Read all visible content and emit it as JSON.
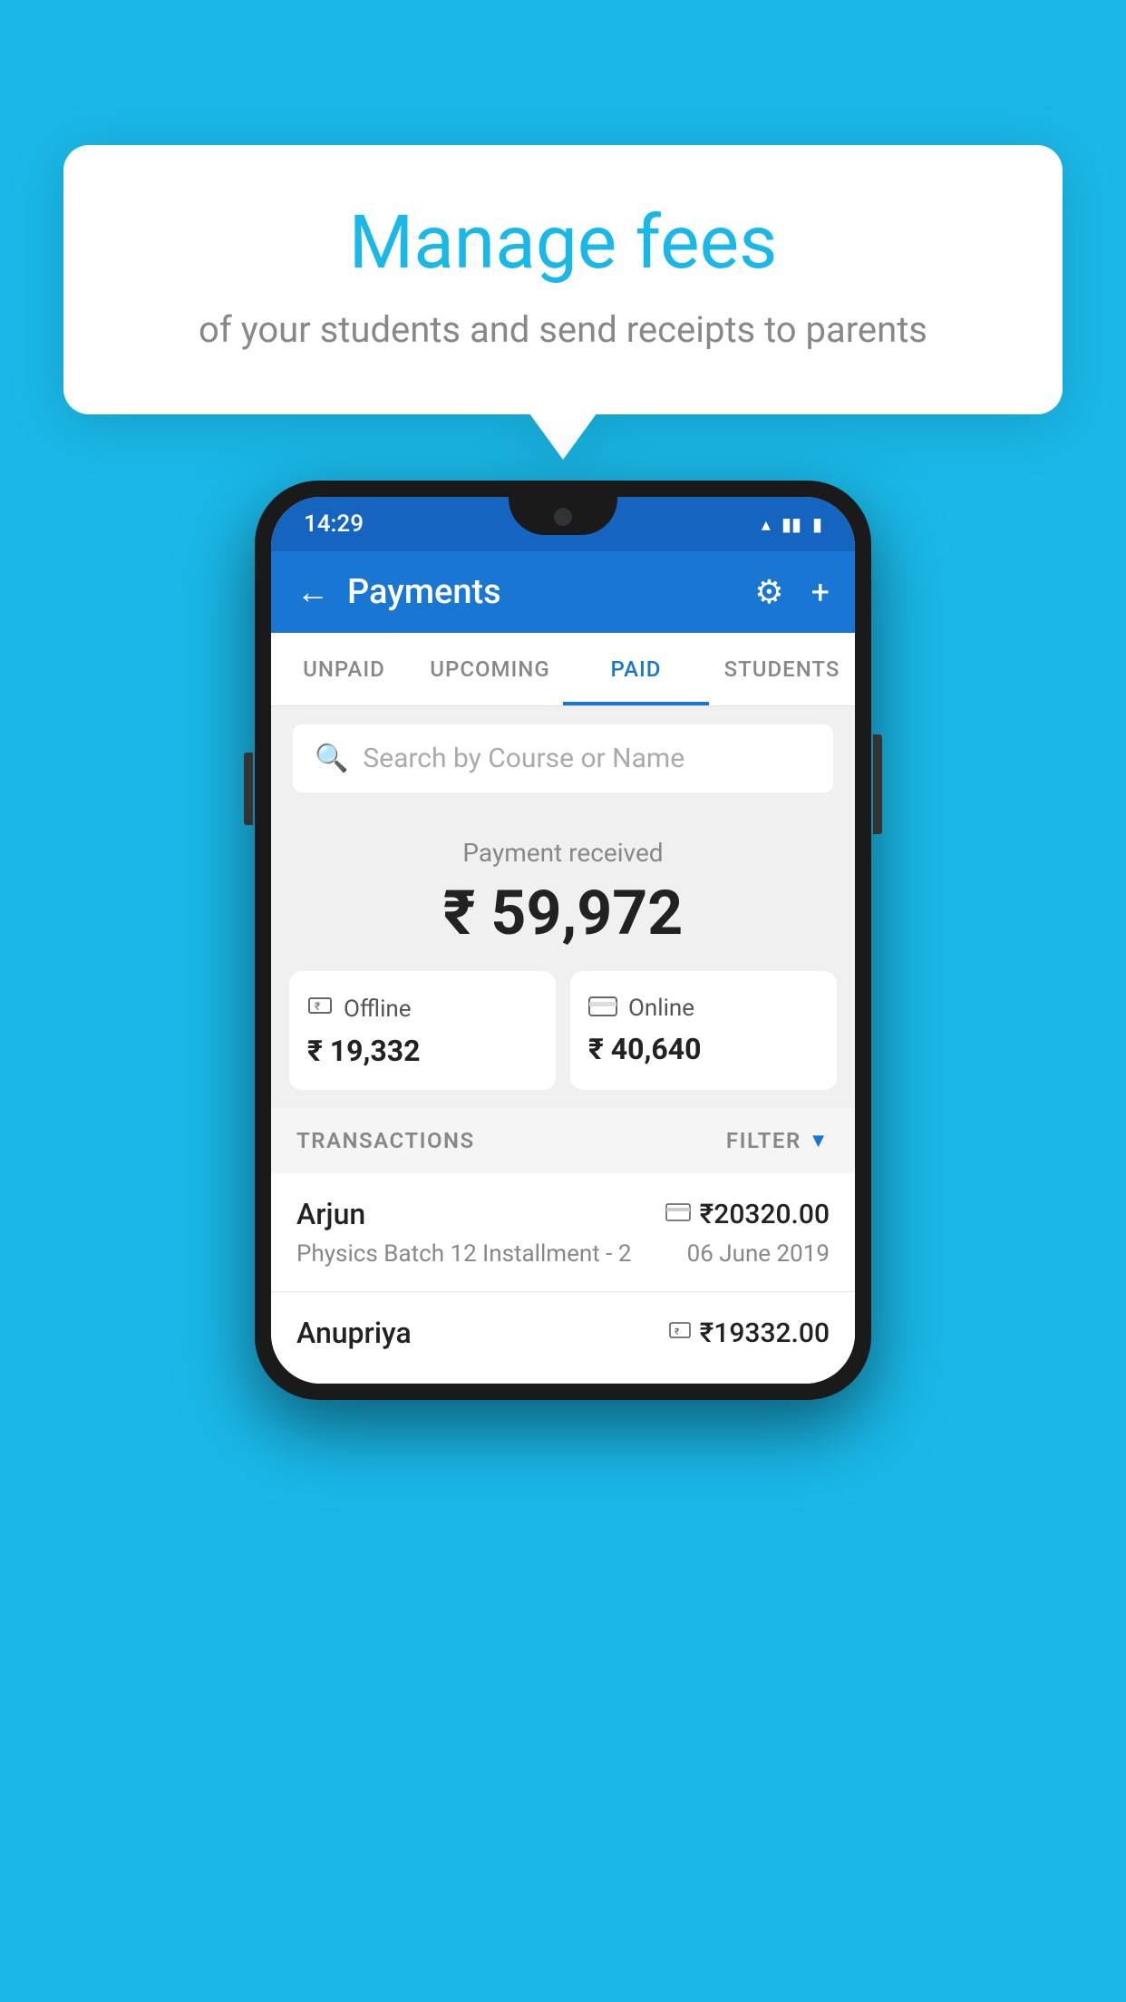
{
  "background_color": "#1ab8e8",
  "tooltip": {
    "title": "Manage fees",
    "subtitle": "of your students and send receipts to parents"
  },
  "phone": {
    "status_bar": {
      "time": "14:29",
      "icons": [
        "wifi",
        "signal",
        "battery"
      ]
    },
    "header": {
      "title": "Payments",
      "back_label": "←",
      "gear_label": "⚙",
      "plus_label": "+"
    },
    "tabs": [
      {
        "label": "UNPAID",
        "active": false
      },
      {
        "label": "UPCOMING",
        "active": false
      },
      {
        "label": "PAID",
        "active": true
      },
      {
        "label": "STUDENTS",
        "active": false
      }
    ],
    "search": {
      "placeholder": "Search by Course or Name"
    },
    "payment_summary": {
      "label": "Payment received",
      "amount": "₹ 59,972",
      "offline": {
        "label": "Offline",
        "amount": "₹ 19,332",
        "icon": "₹"
      },
      "online": {
        "label": "Online",
        "amount": "₹ 40,640",
        "icon": "▭"
      }
    },
    "transactions": {
      "section_label": "TRANSACTIONS",
      "filter_label": "FILTER",
      "items": [
        {
          "name": "Arjun",
          "detail": "Physics Batch 12 Installment - 2",
          "amount": "₹20320.00",
          "date": "06 June 2019",
          "payment_type": "card"
        },
        {
          "name": "Anupriya",
          "detail": "",
          "amount": "₹19332.00",
          "date": "",
          "payment_type": "cash"
        }
      ]
    }
  }
}
